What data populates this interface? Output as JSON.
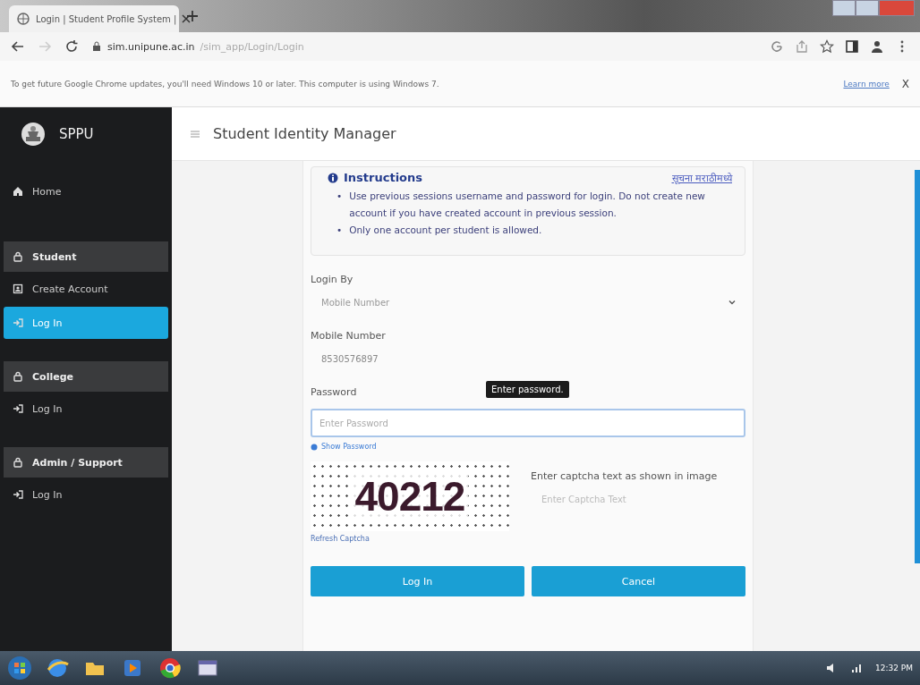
{
  "browser": {
    "tab_title": "Login | Student Profile System |",
    "url_host": "sim.unipune.ac.in",
    "url_path": "/sim_app/Login/Login"
  },
  "infobar": {
    "message": "To get future Google Chrome updates, you'll need Windows 10 or later. This computer is using Windows 7.",
    "link": "Learn more",
    "close": "X"
  },
  "sidebar": {
    "brand": "SPPU",
    "items": [
      {
        "kind": "home",
        "label": "Home",
        "selected": false
      },
      {
        "kind": "group",
        "label": "Student"
      },
      {
        "kind": "register",
        "label": "Create Account",
        "selected": false
      },
      {
        "kind": "login",
        "label": "Log In",
        "selected": true
      },
      {
        "kind": "group",
        "label": "College"
      },
      {
        "kind": "login",
        "label": "Log In",
        "selected": false
      },
      {
        "kind": "group",
        "label": "Admin / Support"
      },
      {
        "kind": "login",
        "label": "Log In",
        "selected": false
      }
    ]
  },
  "header": {
    "title": "Student Identity Manager"
  },
  "instructions": {
    "title": "Instructions",
    "marathi_link": "सूचना मराठीमध्ये",
    "items": [
      {
        "bullet": "•",
        "text": "Use previous sessions username and password for login. Do not create new account if you have created account in previous session."
      },
      {
        "bullet": "•",
        "text": "Only one account per student is allowed."
      }
    ]
  },
  "form": {
    "login_by": {
      "label": "Login By",
      "value": "Mobile Number"
    },
    "mobile": {
      "label": "Mobile Number",
      "value": "8530576897"
    },
    "password": {
      "label": "Password",
      "placeholder": "Enter Password",
      "tooltip": "Enter password.",
      "show_link": "Show Password"
    },
    "captcha": {
      "image_text": "40212",
      "refresh": "Refresh Captcha",
      "label": "Enter captcha text as shown in image",
      "placeholder": "Enter Captcha Text"
    },
    "buttons": [
      "Log In",
      "Cancel"
    ]
  },
  "taskbar": {
    "time": "12:32 PM"
  }
}
